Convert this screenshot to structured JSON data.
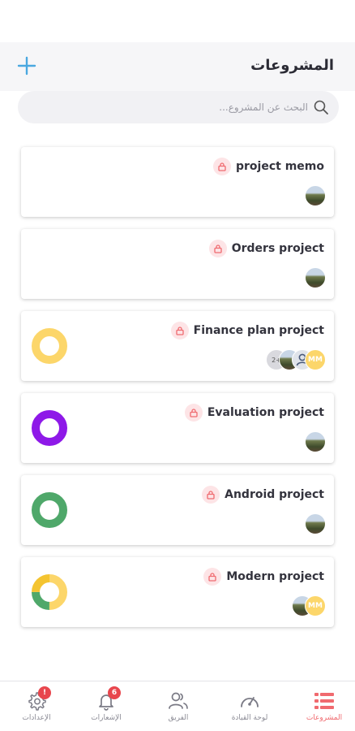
{
  "header": {
    "title": "المشروعات"
  },
  "search": {
    "placeholder": "البحث عن المشروع..."
  },
  "projects": [
    {
      "name": "project memo",
      "members": [
        "photo"
      ],
      "ring": null
    },
    {
      "name": "Orders project",
      "members": [
        "photo"
      ],
      "ring": null
    },
    {
      "name": "Finance plan project",
      "members": [
        "MM",
        "user",
        "photo",
        "2+"
      ],
      "ring": {
        "colors": [
          "#fcd66a"
        ],
        "fractions": [
          1.0
        ]
      }
    },
    {
      "name": "Evaluation project",
      "members": [
        "photo"
      ],
      "ring": {
        "colors": [
          "#8e19e8"
        ],
        "fractions": [
          1.0
        ]
      }
    },
    {
      "name": "Android project",
      "members": [
        "photo"
      ],
      "ring": {
        "colors": [
          "#4fa86a"
        ],
        "fractions": [
          1.0
        ]
      }
    },
    {
      "name": "Modern project",
      "members": [
        "MM",
        "photo"
      ],
      "ring": {
        "colors": [
          "#fcd66a",
          "#4fa86a",
          "#f4c430"
        ],
        "fractions": [
          0.5,
          0.25,
          0.25
        ]
      }
    }
  ],
  "nav": [
    {
      "label": "المشروعات",
      "icon": "list-icon",
      "active": true
    },
    {
      "label": "لوحة القيادة",
      "icon": "dashboard-gauge-icon",
      "active": false
    },
    {
      "label": "الفريق",
      "icon": "team-icon",
      "active": false
    },
    {
      "label": "الإشعارات",
      "icon": "bell-icon",
      "active": false,
      "badge": "6"
    },
    {
      "label": "الإعدادات",
      "icon": "gear-icon",
      "active": false,
      "badge": "!"
    }
  ],
  "colors": {
    "accent": "#f06a6f",
    "add": "#4aa8e0",
    "lock_bg": "#fde4e6",
    "lock": "#f06a6f"
  }
}
